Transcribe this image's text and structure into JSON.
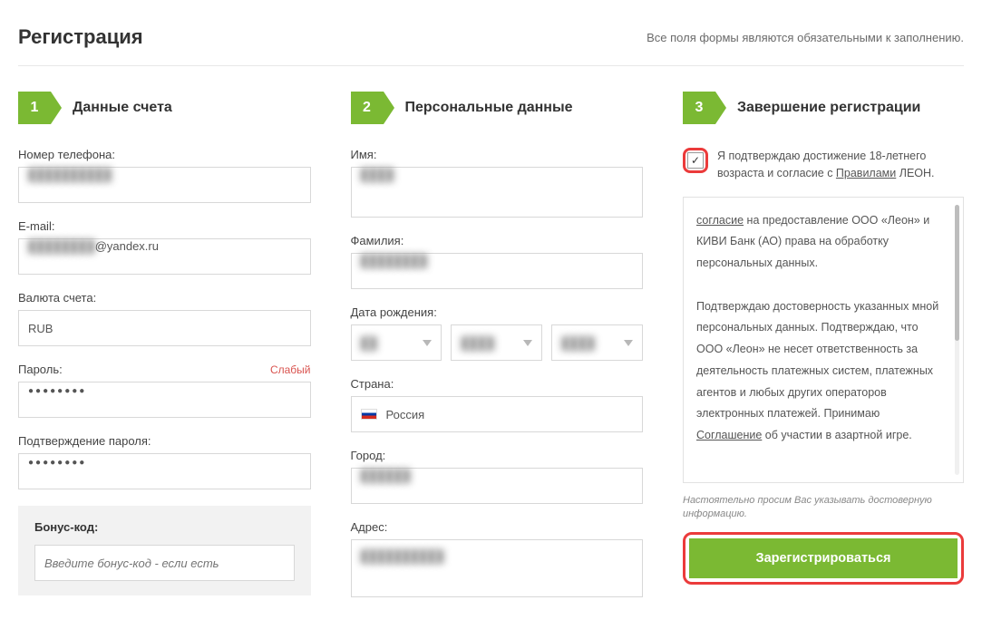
{
  "header": {
    "title": "Регистрация",
    "note": "Все поля формы являются обязательными к заполнению."
  },
  "steps": {
    "s1": {
      "num": "1",
      "title": "Данные счета"
    },
    "s2": {
      "num": "2",
      "title": "Персональные данные"
    },
    "s3": {
      "num": "3",
      "title": "Завершение регистрации"
    }
  },
  "col1": {
    "phone_label": "Номер телефона:",
    "email_label": "E-mail:",
    "email_domain": "@yandex.ru",
    "currency_label": "Валюта счета:",
    "currency_value": "RUB",
    "password_label": "Пароль:",
    "password_strength": "Слабый",
    "password_confirm_label": "Подтверждение пароля:",
    "bonus_label": "Бонус-код:",
    "bonus_placeholder": "Введите бонус-код - если есть"
  },
  "col2": {
    "firstname_label": "Имя:",
    "lastname_label": "Фамилия:",
    "dob_label": "Дата рождения:",
    "country_label": "Страна:",
    "country_value": "Россия",
    "city_label": "Город:",
    "address_label": "Адрес:"
  },
  "col3": {
    "confirm_text_pre": "Я подтверждаю достижение 18-летнего возраста и согласие с ",
    "confirm_rules_link": "Правилами",
    "confirm_text_post": " ЛЕОН.",
    "terms_p1_pre": "согласие",
    "terms_p1_rest": " на предоставление ООО «Леон» и КИВИ Банк (АО) права на обработку персональных данных.",
    "terms_p2_pre": "Подтверждаю достоверность указанных мной персональных данных. Подтверждаю, что ООО «Леон» не несет ответственность за деятельность платежных систем, платежных агентов и любых других операторов электронных платежей. Принимаю ",
    "terms_p2_link": "Соглашение",
    "terms_p2_post": " об участии в азартной игре.",
    "disclaimer": "Настоятельно просим Вас указывать достоверную информацию.",
    "submit_label": "Зарегистрироваться"
  }
}
